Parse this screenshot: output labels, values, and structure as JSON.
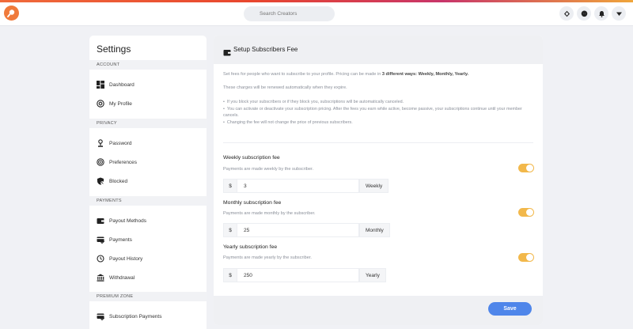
{
  "topbar": {
    "search_placeholder": "Search Creators",
    "icons": [
      "logo-icon",
      "search-icon",
      "diamond-icon",
      "messenger-icon",
      "bell-icon",
      "caret-down-icon"
    ]
  },
  "sidebar": {
    "title": "Settings",
    "sections": {
      "account": "ACCOUNT",
      "privacy": "PRIVACY",
      "payments": "PAYMENTS",
      "premium": "PREMIUM ZONE"
    },
    "items": {
      "dashboard": "Dashboard",
      "my_profile": "My Profile",
      "password": "Password",
      "preferences": "Preferences",
      "blocked": "Blocked",
      "payout_methods": "Payout Methods",
      "payments": "Payments",
      "payout_history": "Payout History",
      "withdrawal": "Withdrawal",
      "subscription_payments": "Subscription Payments"
    }
  },
  "panel": {
    "title": "Setup Subscribers Fee",
    "description_prefix": "Set fees for people who want to subscribe to your profile. Pricing can be made in ",
    "description_bold": "3 different ways: Weekly, Monthly, Yearly.",
    "note": "These charges will be renewed automatically when they expire.",
    "bullets": [
      "If you block your subscribers or if they block you, subscriptions will be automatically canceled.",
      "You can activate or deactivate your subscription pricing. After the fees you earn while active, become passive, your subscriptions continue until your member cancels.",
      "Changing the fee will not change the price of previous subscribers."
    ],
    "weekly": {
      "label": "Weekly subscription fee",
      "sub": "Payments are made weekly by the subscriber.",
      "currency": "$",
      "value": "3",
      "period": "Weekly",
      "enabled": true
    },
    "monthly": {
      "label": "Monthly subscription fee",
      "sub": "Payments are made monthly by the subscriber.",
      "currency": "$",
      "value": "25",
      "period": "Monthly",
      "enabled": true
    },
    "yearly": {
      "label": "Yearly subscription fee",
      "sub": "Payments are made yearly by the subscriber.",
      "currency": "$",
      "value": "250",
      "period": "Yearly",
      "enabled": true
    },
    "save_label": "Save"
  },
  "colors": {
    "accent": "#4f86ea",
    "toggle_on": "#f2b84b",
    "logo": "#f07a3b"
  }
}
